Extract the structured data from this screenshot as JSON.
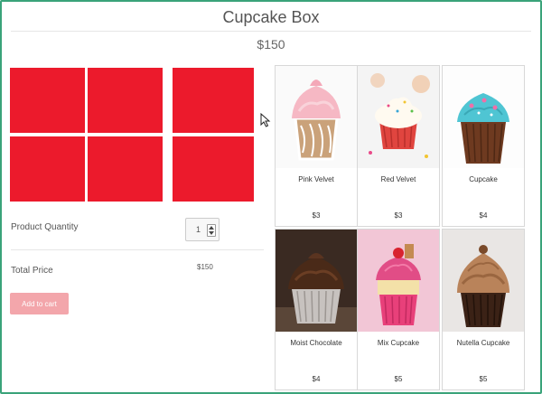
{
  "header": {
    "title": "Cupcake Box",
    "price": "$150"
  },
  "box": {
    "slots": 6,
    "slot_color": "#ec1a2c"
  },
  "quantity": {
    "label": "Product Quantity",
    "value": "1"
  },
  "total": {
    "label": "Total Price",
    "value": "$150"
  },
  "cart": {
    "button_label": "Add to cart",
    "button_color": "#f3a6ab"
  },
  "products": [
    {
      "name": "Pink Velvet",
      "price": "$3",
      "icon": "pink-velvet-cupcake-image"
    },
    {
      "name": "Red Velvet",
      "price": "$3",
      "icon": "red-velvet-cupcake-image"
    },
    {
      "name": "Cupcake",
      "price": "$4",
      "icon": "blue-frosting-cupcake-image"
    },
    {
      "name": "Moist Chocolate",
      "price": "$4",
      "icon": "chocolate-cupcake-image"
    },
    {
      "name": "Mix Cupcake",
      "price": "$5",
      "icon": "mix-cupcake-image"
    },
    {
      "name": "Nutella Cupcake",
      "price": "$5",
      "icon": "nutella-cupcake-image"
    }
  ],
  "accent": "#3aa37a"
}
